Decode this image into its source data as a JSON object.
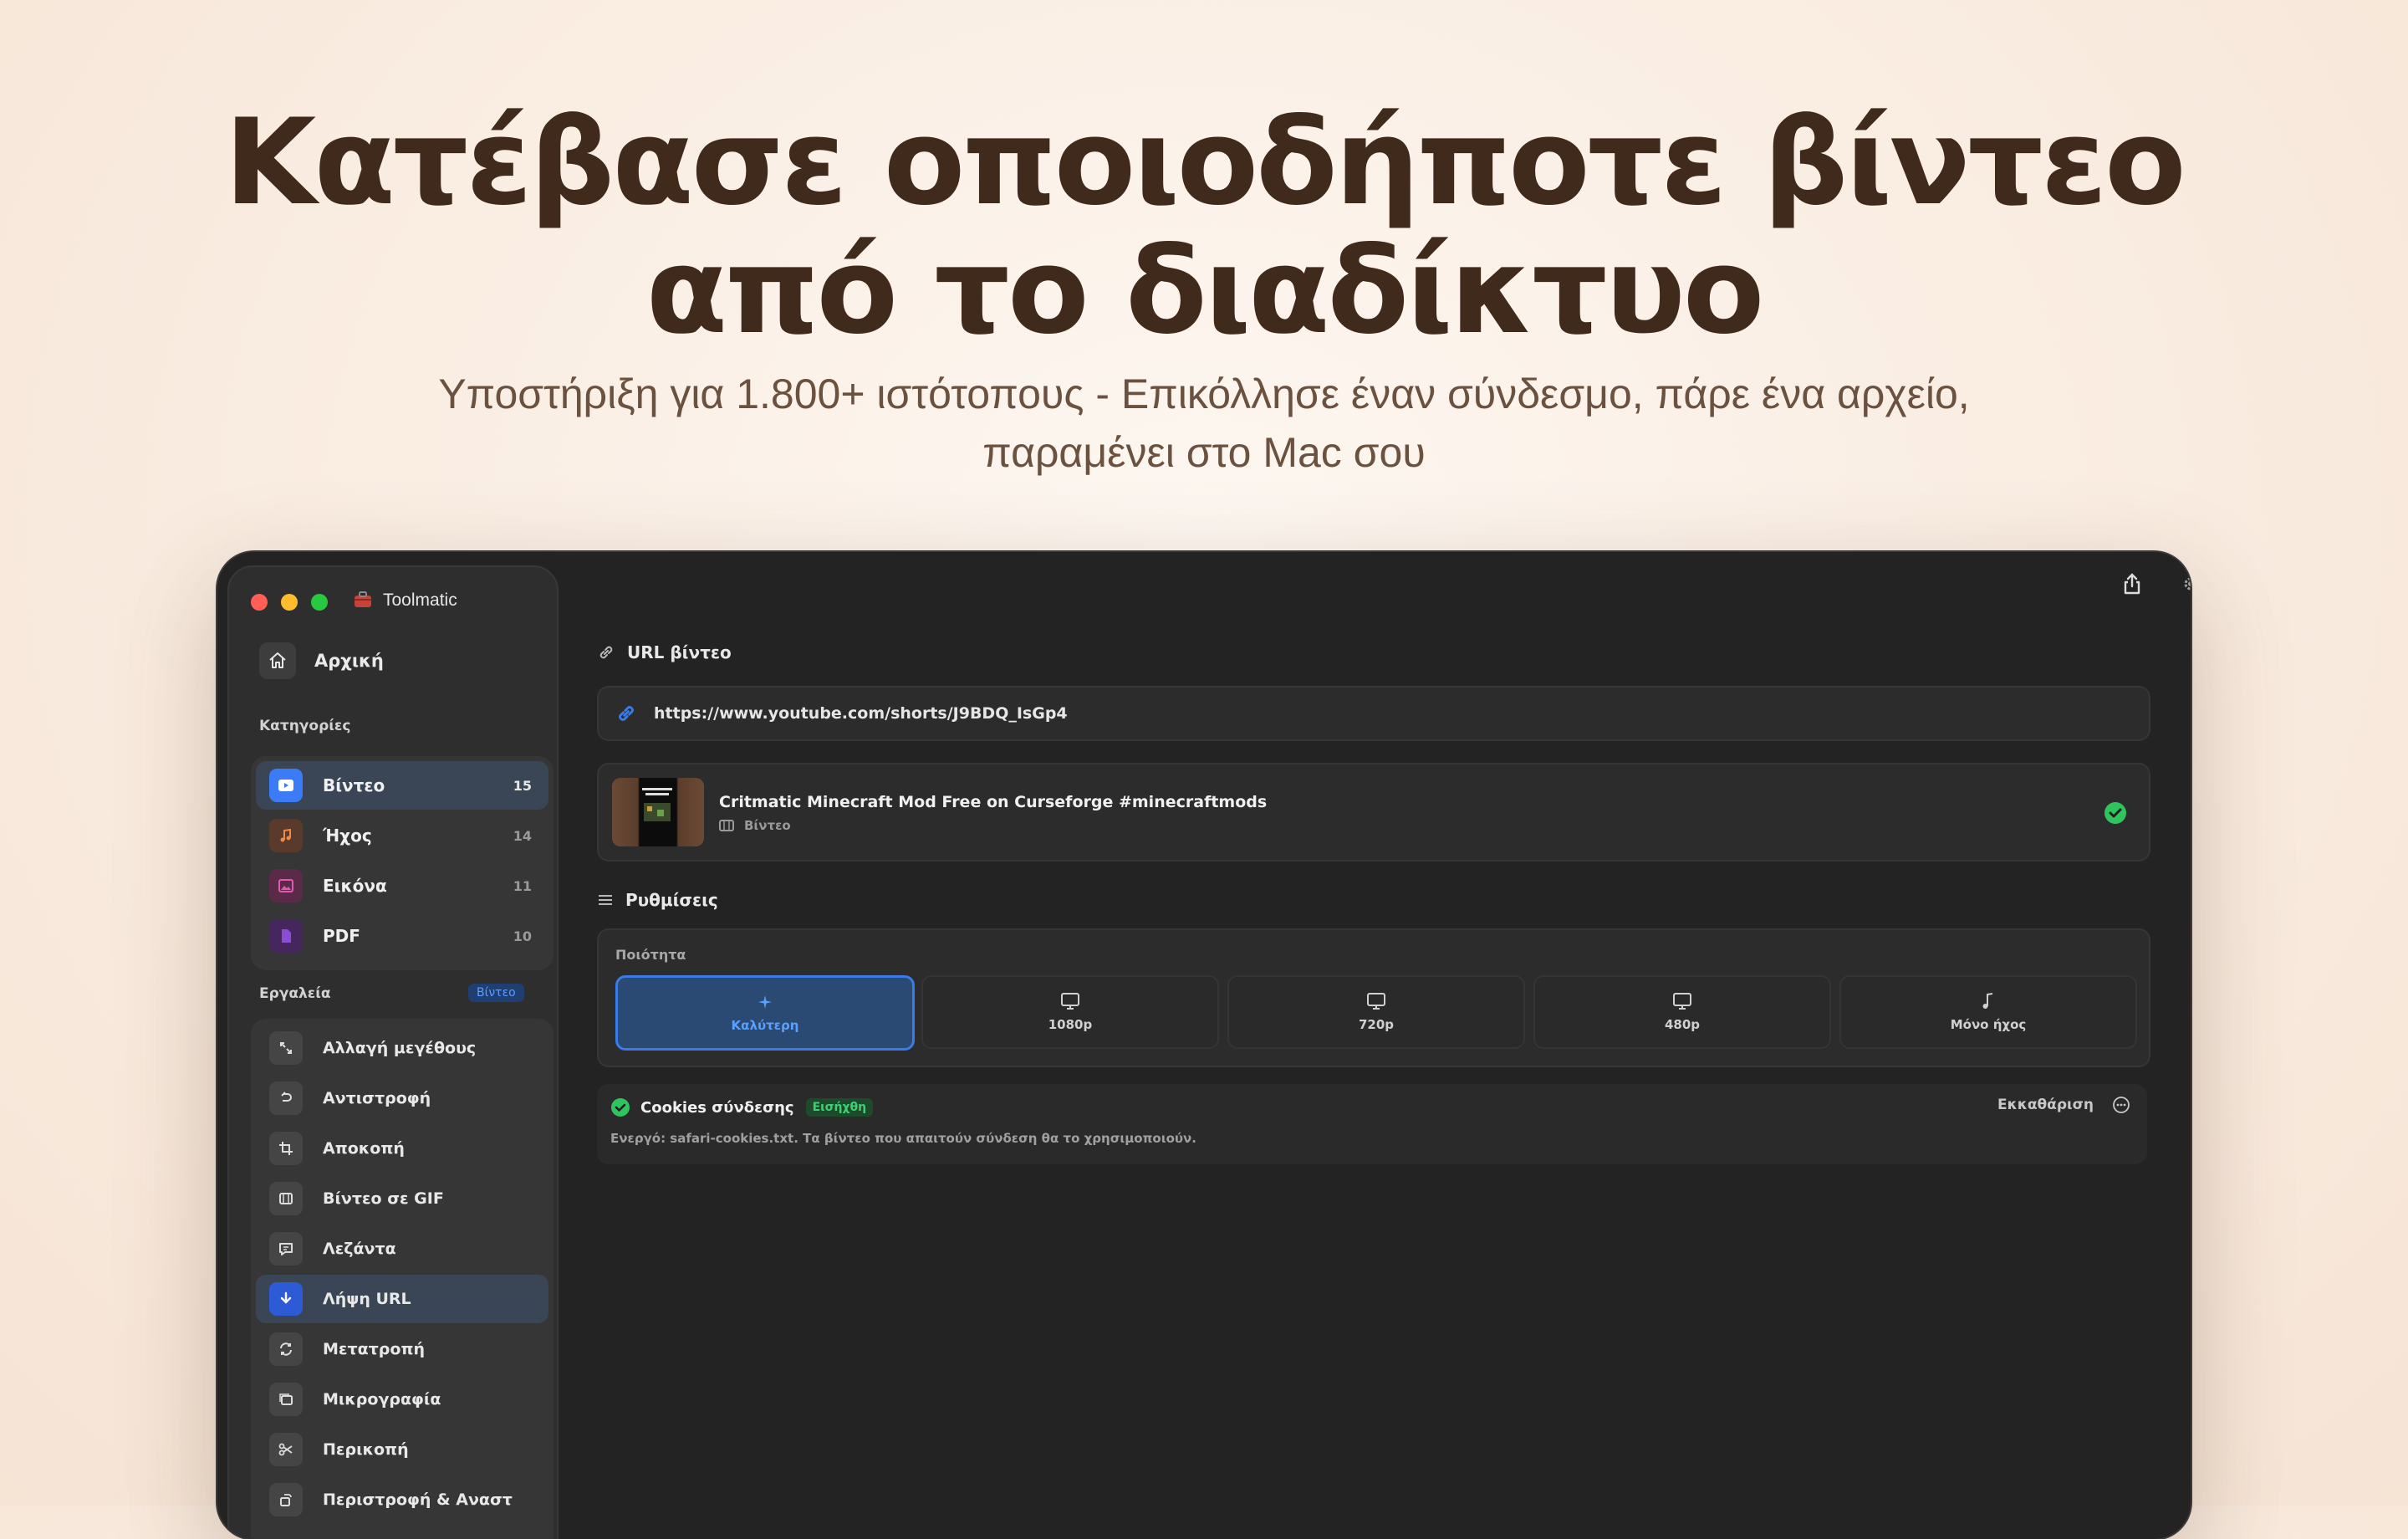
{
  "hero": {
    "title_line1": "Κατέβασε οποιοδήποτε βίντεο",
    "title_line2": "από το διαδίκτυο",
    "subtitle_line1": "Υποστήριξη για 1.800+ ιστότοπους - Επικόλλησε έναν σύνδεσμο, πάρε ένα αρχείο,",
    "subtitle_line2": "παραμένει στο Mac σου"
  },
  "window": {
    "app_title": "Toolmatic"
  },
  "sidebar": {
    "home_label": "Αρχική",
    "categories_header": "Κατηγορίες",
    "categories": [
      {
        "label": "Βίντεο",
        "count": "15",
        "icon": "play-icon",
        "color": "#3b7cf6"
      },
      {
        "label": "Ήχος",
        "count": "14",
        "icon": "music-note-icon",
        "color": "#e0733a"
      },
      {
        "label": "Εικόνα",
        "count": "11",
        "icon": "image-icon",
        "color": "#d4449b"
      },
      {
        "label": "PDF",
        "count": "10",
        "icon": "document-icon",
        "color": "#8b4cd6"
      }
    ],
    "tools_header": "Εργαλεία",
    "tools_badge": "Βίντεο",
    "tools": [
      {
        "label": "Αλλαγή μεγέθους",
        "icon": "resize-icon"
      },
      {
        "label": "Αντιστροφή",
        "icon": "reverse-icon"
      },
      {
        "label": "Αποκοπή",
        "icon": "crop-icon"
      },
      {
        "label": "Βίντεο σε GIF",
        "icon": "film-icon"
      },
      {
        "label": "Λεζάντα",
        "icon": "caption-icon"
      },
      {
        "label": "Λήψη URL",
        "icon": "download-icon",
        "active": true
      },
      {
        "label": "Μετατροπή",
        "icon": "convert-icon"
      },
      {
        "label": "Μικρογραφία",
        "icon": "thumbnail-icon"
      },
      {
        "label": "Περικοπή",
        "icon": "scissors-icon"
      },
      {
        "label": "Περιστροφή & Αναστ",
        "icon": "rotate-icon"
      }
    ]
  },
  "main": {
    "url_section_title": "URL βίντεο",
    "url_value": "https://www.youtube.com/shorts/J9BDQ_IsGp4",
    "video": {
      "title": "Critmatic Minecraft Mod Free on Curseforge #minecraftmods",
      "type": "Βίντεο"
    },
    "settings_title": "Ρυθμίσεις",
    "quality_label": "Ποιότητα",
    "quality_options": [
      {
        "label": "Καλύτερη",
        "icon": "sparkle-icon",
        "active": true
      },
      {
        "label": "1080p",
        "icon": "monitor-icon"
      },
      {
        "label": "720p",
        "icon": "monitor-icon"
      },
      {
        "label": "480p",
        "icon": "monitor-icon"
      },
      {
        "label": "Μόνο ήχος",
        "icon": "music-note-icon"
      }
    ],
    "cookies": {
      "title": "Cookies σύνδεσης",
      "badge": "Εισήχθη",
      "description": "Ενεργό: safari-cookies.txt. Τα βίντεο που απαιτούν σύνδεση θα το χρησιμοποιούν.",
      "clear_label": "Εκκαθάριση"
    }
  },
  "colors": {
    "accent": "#3a7be8",
    "success": "#2fc45e",
    "headline": "#3f2a1c"
  }
}
